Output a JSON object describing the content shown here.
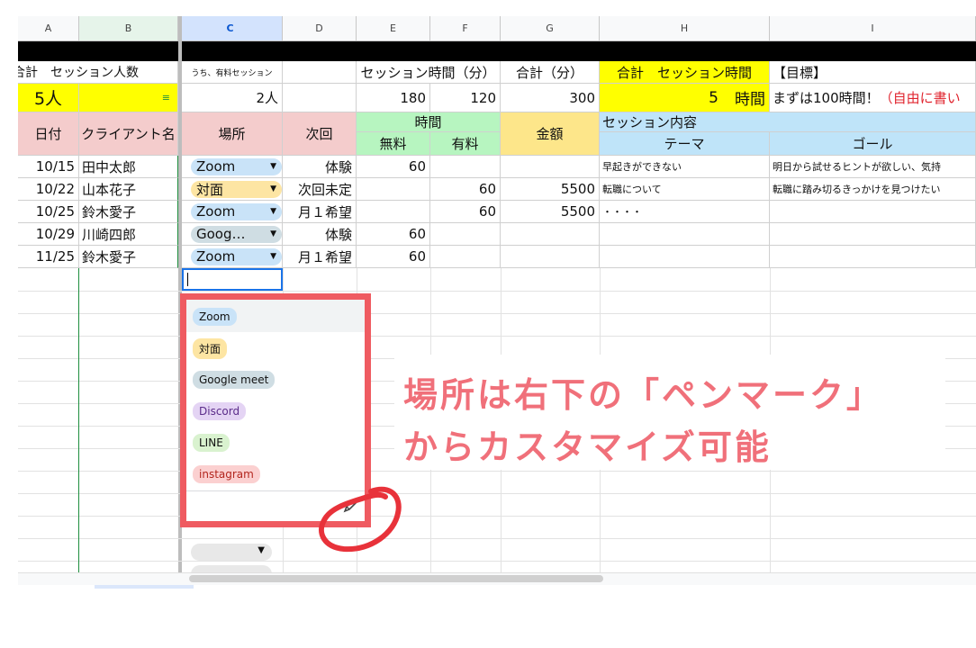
{
  "column_headers": [
    "A",
    "B",
    "C",
    "D",
    "E",
    "F",
    "G",
    "H",
    "I"
  ],
  "header_row1": {
    "a_b": "合計　セッション人数",
    "c": "うち、有料セッション",
    "e_f": "セッション時間（分）",
    "g": "合計（分）",
    "h": "合計　セッション時間",
    "i": "【目標】"
  },
  "header_row2": {
    "a": "5人",
    "c": "2人",
    "e": "180",
    "f": "120",
    "g": "300",
    "h_num": "5",
    "h_unit": "時間",
    "i_black": "まずは100時間！",
    "i_red": "（自由に書い"
  },
  "table_headers": {
    "date": "日付",
    "client": "クライアント名",
    "place": "場所",
    "next": "次回",
    "time": "時間",
    "free": "無料",
    "paid": "有料",
    "amount": "金額",
    "content": "セッション内容",
    "theme": "テーマ",
    "goal": "ゴール"
  },
  "rows": [
    {
      "date": "10/15",
      "client": "田中太郎",
      "place": "Zoom",
      "next": "体験",
      "free": "60",
      "paid": "",
      "amount": "",
      "theme": "早起きができない",
      "goal": "明日から試せるヒントが欲しい、気持"
    },
    {
      "date": "10/22",
      "client": "山本花子",
      "place": "対面",
      "next": "次回未定",
      "free": "",
      "paid": "60",
      "amount": "5500",
      "theme": "転職について",
      "goal": "転職に踏み切るきっかけを見つけたい"
    },
    {
      "date": "10/25",
      "client": "鈴木愛子",
      "place": "Zoom",
      "next": "月１希望",
      "free": "",
      "paid": "60",
      "amount": "5500",
      "theme": "・・・・",
      "goal": ""
    },
    {
      "date": "10/29",
      "client": "川崎四郎",
      "place": "Goog…",
      "next": "体験",
      "free": "60",
      "paid": "",
      "amount": "",
      "theme": "",
      "goal": ""
    },
    {
      "date": "11/25",
      "client": "鈴木愛子",
      "place": "Zoom",
      "next": "月１希望",
      "free": "60",
      "paid": "",
      "amount": "",
      "theme": "",
      "goal": ""
    }
  ],
  "dropdown_options": [
    "Zoom",
    "対面",
    "Google meet",
    "Discord",
    "LINE",
    "instagram"
  ],
  "annotation": {
    "line1": "場所は右下の「ペンマーク」",
    "line2": "からカスタマイズ可能"
  },
  "colors": {
    "zoom_chip": "#c9e3f8",
    "taimen_chip": "#fde5a3",
    "gmeet_chip": "#cfdde3",
    "discord_chip": "#e4d4f4",
    "line_chip": "#d9f2cf",
    "instagram_chip": "#fbd0d0",
    "annotation_red": "#ef5b61",
    "annotation_text": "#f0707a"
  },
  "icons": [
    "dropdown-arrow-icon",
    "pencil-icon",
    "filter-icon"
  ]
}
